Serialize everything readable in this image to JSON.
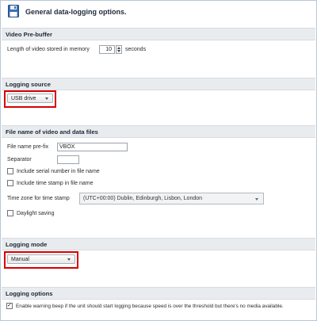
{
  "header": {
    "title": "General data-logging options.",
    "icon": "floppy-disk-icon"
  },
  "video_prebuffer": {
    "section_title": "Video Pre-buffer",
    "length_label": "Length of video stored in memory",
    "length_value": "10",
    "length_unit": "seconds"
  },
  "logging_source": {
    "section_title": "Logging source",
    "selected": "USB drive"
  },
  "file_name": {
    "section_title": "File name of video and data files",
    "prefix_label": "File name pre-fix",
    "prefix_value": "VBOX",
    "separator_label": "Separator",
    "separator_value": "",
    "include_serial_label": "Include serial number in file name",
    "include_serial_checked": false,
    "include_timestamp_label": "Include time stamp in file name",
    "include_timestamp_checked": false,
    "timezone_label": "Time zone for time stamp",
    "timezone_value": "(UTC+00:00) Dublin, Edinburgh, Lisbon, London",
    "daylight_label": "Daylight saving",
    "daylight_checked": false
  },
  "logging_mode": {
    "section_title": "Logging mode",
    "selected": "Manual"
  },
  "logging_options": {
    "section_title": "Logging options",
    "warning_beep_label": "Enable warning beep if the unit should start logging because speed is over the threshold but there's no media available.",
    "warning_beep_checked": true
  },
  "colors": {
    "highlight": "#d90000",
    "section_bg": "#e9ecef"
  }
}
